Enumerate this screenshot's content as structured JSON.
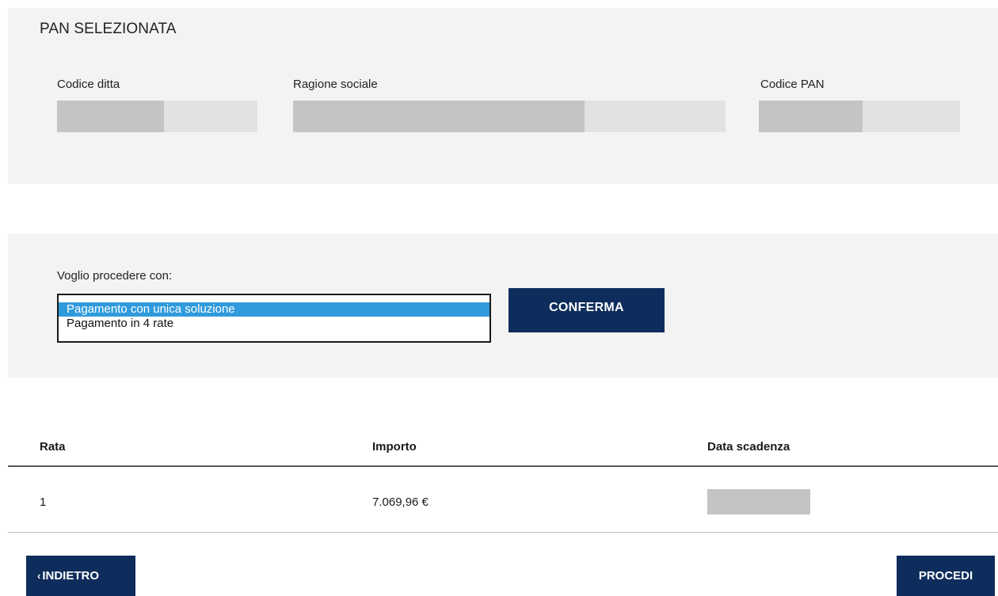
{
  "pan_section": {
    "title": "PAN SELEZIONATA",
    "fields": {
      "codice_ditta": {
        "label": "Codice ditta",
        "value": ""
      },
      "ragione_sociale": {
        "label": "Ragione sociale",
        "value": ""
      },
      "codice_pan": {
        "label": "Codice PAN",
        "value": ""
      }
    }
  },
  "payment_choice": {
    "label": "Voglio procedere con:",
    "options": [
      "Pagamento con unica soluzione",
      "Pagamento in 4 rate"
    ],
    "selected": "Pagamento con unica soluzione",
    "confirm_label": "CONFERMA"
  },
  "installments_table": {
    "columns": [
      "Rata",
      "Importo",
      "Data scadenza"
    ],
    "rows": [
      {
        "rata": "1",
        "importo": "7.069,96 €",
        "data_scadenza": ""
      }
    ]
  },
  "nav": {
    "back_chevron": "‹",
    "back_label": "INDIETRO",
    "next_label": "PROCEDI"
  },
  "colors": {
    "panel_bg": "#f3f3f3",
    "primary_button": "#0e2d5c",
    "selection_highlight": "#2f9bdc",
    "masked_value": "#c4c4c4"
  }
}
